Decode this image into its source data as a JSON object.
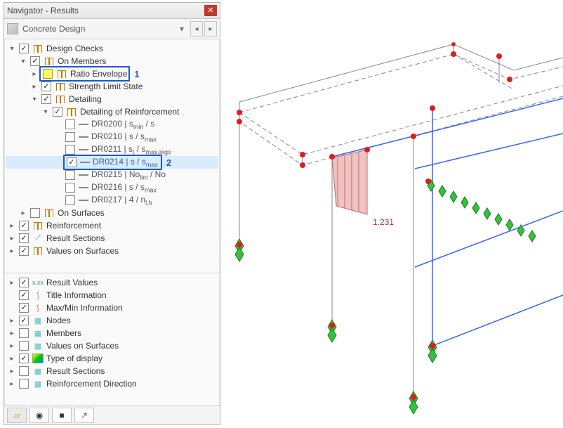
{
  "window": {
    "title": "Navigator - Results"
  },
  "selector": {
    "label": "Concrete Design"
  },
  "callouts": {
    "one": "1",
    "two": "2"
  },
  "tree": {
    "design_checks": "Design Checks",
    "on_members": "On Members",
    "ratio_envelope": "Ratio Envelope",
    "strength_limit_state": "Strength Limit State",
    "detailing": "Detailing",
    "detailing_of_reinforcement": "Detailing of Reinforcement",
    "dr0200": "DR0200 | s",
    "dr0200_suf": "min",
    "dr0200_end": " / s",
    "dr0210": "DR0210 | s / s",
    "dr0210_suf": "max",
    "dr0211": "DR0211 | s",
    "dr0211_mid": "t",
    "dr0211_end": " / s",
    "dr0211_suf": "max,legs",
    "dr0214": "DR0214 | s / s",
    "dr0214_suf": "max",
    "dr0215": "DR0215 | No",
    "dr0215_mid": "lim",
    "dr0215_end": " / No",
    "dr0216": "DR0216 | s / s",
    "dr0216_suf": "max",
    "dr0217": "DR0217 | 4 / n",
    "dr0217_suf": "l,b",
    "on_surfaces": "On Surfaces",
    "reinforcement": "Reinforcement",
    "result_sections": "Result Sections",
    "values_on_surfaces": "Values on Surfaces"
  },
  "tree2": {
    "result_values": "Result Values",
    "title_information": "Title Information",
    "maxmin_information": "Max/Min Information",
    "nodes": "Nodes",
    "members": "Members",
    "values_on_surfaces": "Values on Surfaces",
    "type_of_display": "Type of display",
    "result_sections": "Result Sections",
    "reinforcement_direction": "Reinforcement Direction"
  },
  "viewport": {
    "value_label": "1.231"
  },
  "icons": {
    "close": "✕",
    "dropdown": "▾",
    "arrow_left": "◂",
    "arrow_right": "▸",
    "expand_open": "▾",
    "expand_closed": "▸"
  }
}
